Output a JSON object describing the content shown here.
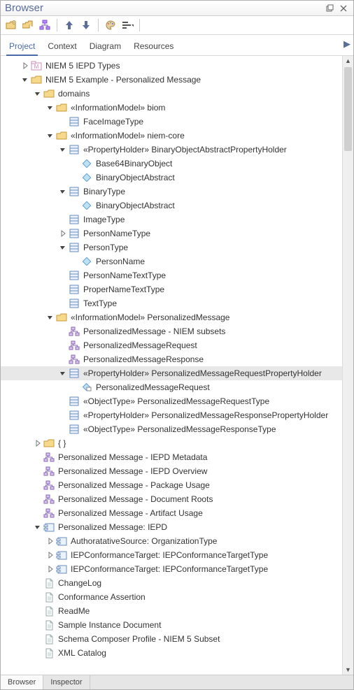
{
  "window": {
    "title": "Browser"
  },
  "tabs": {
    "items": [
      "Project",
      "Context",
      "Diagram",
      "Resources"
    ],
    "active": 0
  },
  "footer": {
    "items": [
      "Browser",
      "Inspector"
    ],
    "active": 0
  },
  "colors": {
    "accent": "#5b6d9b",
    "selectBg": "#e8e8e8"
  },
  "toolbar_icons": [
    "folder-plus",
    "folders",
    "tree-struct",
    "sep",
    "arrow-up",
    "arrow-down",
    "sep",
    "palette",
    "align-dropdown",
    "sep"
  ],
  "tree": [
    {
      "l": 0,
      "e": "closed",
      "i": "pkg-m",
      "t": "NIEM 5 IEPD Types"
    },
    {
      "l": 0,
      "e": "open",
      "i": "folder",
      "t": "NIEM 5 Example - Personalized Message"
    },
    {
      "l": 1,
      "e": "open",
      "i": "folder",
      "t": "domains"
    },
    {
      "l": 2,
      "e": "open",
      "i": "folder",
      "t": "«InformationModel» biom"
    },
    {
      "l": 3,
      "e": "none",
      "i": "class",
      "t": "FaceImageType"
    },
    {
      "l": 2,
      "e": "open",
      "i": "folder",
      "t": "«InformationModel» niem-core"
    },
    {
      "l": 3,
      "e": "open",
      "i": "class",
      "t": "«PropertyHolder» BinaryObjectAbstractPropertyHolder"
    },
    {
      "l": 4,
      "e": "none",
      "i": "attr",
      "t": "Base64BinaryObject"
    },
    {
      "l": 4,
      "e": "none",
      "i": "attr",
      "t": "BinaryObjectAbstract"
    },
    {
      "l": 3,
      "e": "open",
      "i": "class",
      "t": "BinaryType"
    },
    {
      "l": 4,
      "e": "none",
      "i": "attr",
      "t": "BinaryObjectAbstract"
    },
    {
      "l": 3,
      "e": "none",
      "i": "class",
      "t": "ImageType"
    },
    {
      "l": 3,
      "e": "closed",
      "i": "class",
      "t": "PersonNameType"
    },
    {
      "l": 3,
      "e": "open",
      "i": "class",
      "t": "PersonType"
    },
    {
      "l": 4,
      "e": "none",
      "i": "attr",
      "t": "PersonName"
    },
    {
      "l": 3,
      "e": "none",
      "i": "class",
      "t": "PersonNameTextType"
    },
    {
      "l": 3,
      "e": "none",
      "i": "class",
      "t": "ProperNameTextType"
    },
    {
      "l": 3,
      "e": "none",
      "i": "class",
      "t": "TextType"
    },
    {
      "l": 2,
      "e": "open",
      "i": "folder",
      "t": "«InformationModel» PersonalizedMessage"
    },
    {
      "l": 3,
      "e": "none",
      "i": "diagram",
      "t": "PersonalizedMessage - NIEM subsets"
    },
    {
      "l": 3,
      "e": "none",
      "i": "diagram",
      "t": "PersonalizedMessageRequest"
    },
    {
      "l": 3,
      "e": "none",
      "i": "diagram",
      "t": "PersonalizedMessageResponse"
    },
    {
      "l": 3,
      "e": "open",
      "i": "class",
      "t": "«PropertyHolder» PersonalizedMessageRequestPropertyHolder",
      "sel": true
    },
    {
      "l": 4,
      "e": "none",
      "i": "attr-b",
      "t": "PersonalizedMessageRequest"
    },
    {
      "l": 3,
      "e": "none",
      "i": "class",
      "t": "«ObjectType» PersonalizedMessageRequestType"
    },
    {
      "l": 3,
      "e": "none",
      "i": "class",
      "t": "«PropertyHolder» PersonalizedMessageResponsePropertyHolder"
    },
    {
      "l": 3,
      "e": "none",
      "i": "class",
      "t": "«ObjectType» PersonalizedMessageResponseType"
    },
    {
      "l": 1,
      "e": "closed",
      "i": "folder-b",
      "t": "{ }"
    },
    {
      "l": 1,
      "e": "none",
      "i": "diagram",
      "t": "Personalized Message - IEPD Metadata"
    },
    {
      "l": 1,
      "e": "none",
      "i": "diagram",
      "t": "Personalized Message - IEPD Overview"
    },
    {
      "l": 1,
      "e": "none",
      "i": "diagram",
      "t": "Personalized Message - Package Usage"
    },
    {
      "l": 1,
      "e": "none",
      "i": "diagram",
      "t": "Personalized Message - Document Roots"
    },
    {
      "l": 1,
      "e": "none",
      "i": "diagram",
      "t": "Personalized Message - Artifact Usage"
    },
    {
      "l": 1,
      "e": "open",
      "i": "comp",
      "t": "Personalized Message: IEPD"
    },
    {
      "l": 2,
      "e": "closed",
      "i": "comp",
      "t": "AuthoratativeSource: OrganizationType"
    },
    {
      "l": 2,
      "e": "closed",
      "i": "comp",
      "t": "IEPConformanceTarget: IEPConformanceTargetType"
    },
    {
      "l": 2,
      "e": "closed",
      "i": "comp",
      "t": "IEPConformanceTarget: IEPConformanceTargetType"
    },
    {
      "l": 1,
      "e": "none",
      "i": "doc",
      "t": "ChangeLog"
    },
    {
      "l": 1,
      "e": "none",
      "i": "doc",
      "t": "Conformance Assertion"
    },
    {
      "l": 1,
      "e": "none",
      "i": "doc",
      "t": "ReadMe"
    },
    {
      "l": 1,
      "e": "none",
      "i": "doc",
      "t": "Sample Instance Document"
    },
    {
      "l": 1,
      "e": "none",
      "i": "doc",
      "t": "Schema Composer Profile - NIEM 5 Subset"
    },
    {
      "l": 1,
      "e": "none",
      "i": "doc",
      "t": "XML Catalog"
    }
  ]
}
